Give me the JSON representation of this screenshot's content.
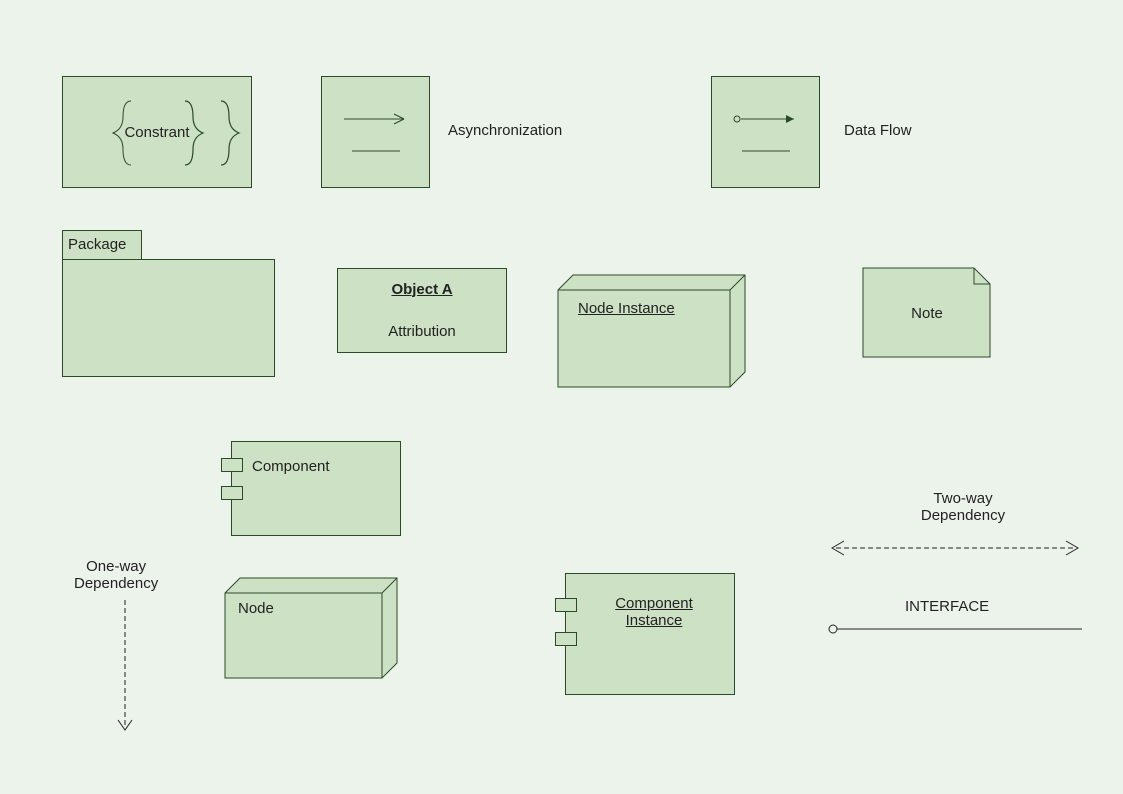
{
  "constraint": {
    "label": "Constrant"
  },
  "async": {
    "label": "Asynchronization"
  },
  "dataflow": {
    "label": "Data Flow"
  },
  "package": {
    "tab_label": "Package"
  },
  "object": {
    "title": "Object A",
    "attr": "Attribution"
  },
  "nodeinstance": {
    "label": "Node Instance"
  },
  "note": {
    "label": "Note"
  },
  "component": {
    "label": "Component"
  },
  "oneway": {
    "label1": "One-way",
    "label2": "Dependency"
  },
  "node": {
    "label": "Node"
  },
  "compinstance": {
    "label1": "Component",
    "label2": "Instance"
  },
  "twoway": {
    "label1": "Two-way",
    "label2": "Dependency"
  },
  "interface": {
    "label": "INTERFACE"
  }
}
